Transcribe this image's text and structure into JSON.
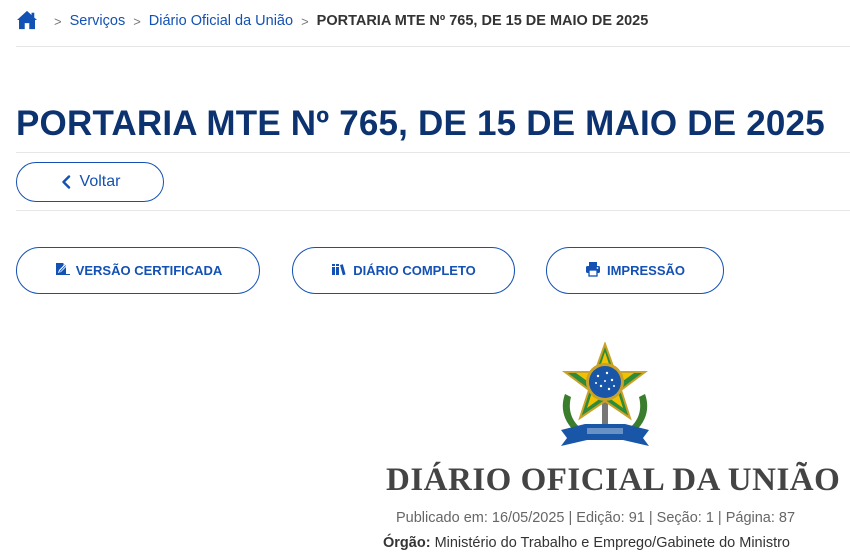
{
  "breadcrumb": {
    "home_icon": "home-icon",
    "separator": ">",
    "items": [
      "Serviços",
      "Diário Oficial da União"
    ],
    "current": "PORTARIA MTE Nº 765, DE 15 DE MAIO DE 2025"
  },
  "page": {
    "title": "PORTARIA MTE Nº 765, DE 15 DE MAIO DE 2025"
  },
  "back_button": {
    "label": "Voltar",
    "icon": "chevron-left-icon"
  },
  "actions": [
    {
      "label": "VERSÃO CERTIFICADA",
      "icon": "certified-edit-icon"
    },
    {
      "label": "DIÁRIO COMPLETO",
      "icon": "books-icon"
    },
    {
      "label": "IMPRESSÃO",
      "icon": "print-icon"
    }
  ],
  "document": {
    "emblem": "brazil-coat-of-arms",
    "header_title": "DIÁRIO OFICIAL DA UNIÃO",
    "publication_info": "Publicado em: 16/05/2025 | Edição: 91 | Seção: 1 | Página: 87",
    "orgao_label": "Órgão:",
    "orgao_value": "Ministério do Trabalho e Emprego/Gabinete do Ministro"
  },
  "colors": {
    "primary_blue": "#1351b4",
    "title_navy": "#0c326f",
    "divider": "#e6e6e6"
  }
}
